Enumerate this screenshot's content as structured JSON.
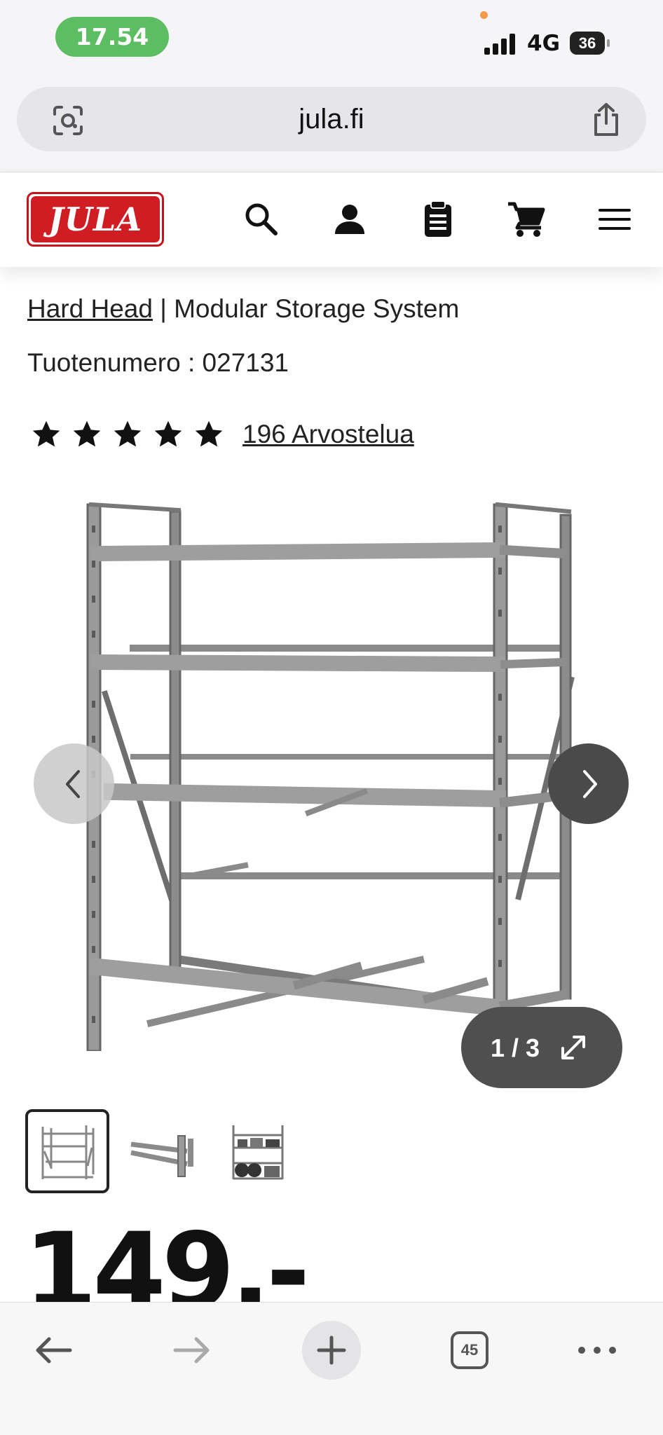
{
  "status_bar": {
    "time": "17.54",
    "network": "4G",
    "battery": "36"
  },
  "browser": {
    "url": "jula.fi",
    "tabs_count": "45"
  },
  "header": {
    "logo_text": "JULA"
  },
  "product": {
    "brand": "Hard Head",
    "separator": " | ",
    "name": "Modular Storage System",
    "product_number_label": "Tuotenumero : ",
    "product_number": "027131",
    "rating_stars": 5,
    "reviews": "196 Arvostelua",
    "image_counter": "1 / 3",
    "price": "149.-"
  },
  "colors": {
    "brand_red": "#d01d23",
    "status_green": "#5cbd62",
    "next_button": "#4a4a4a"
  },
  "icons": [
    "camera-lens-icon",
    "share-icon",
    "search-icon",
    "user-icon",
    "clipboard-icon",
    "cart-icon",
    "menu-icon",
    "star-icon",
    "chevron-left-icon",
    "chevron-right-icon",
    "expand-icon",
    "back-arrow-icon",
    "forward-arrow-icon",
    "plus-icon",
    "tabs-icon",
    "more-icon"
  ]
}
